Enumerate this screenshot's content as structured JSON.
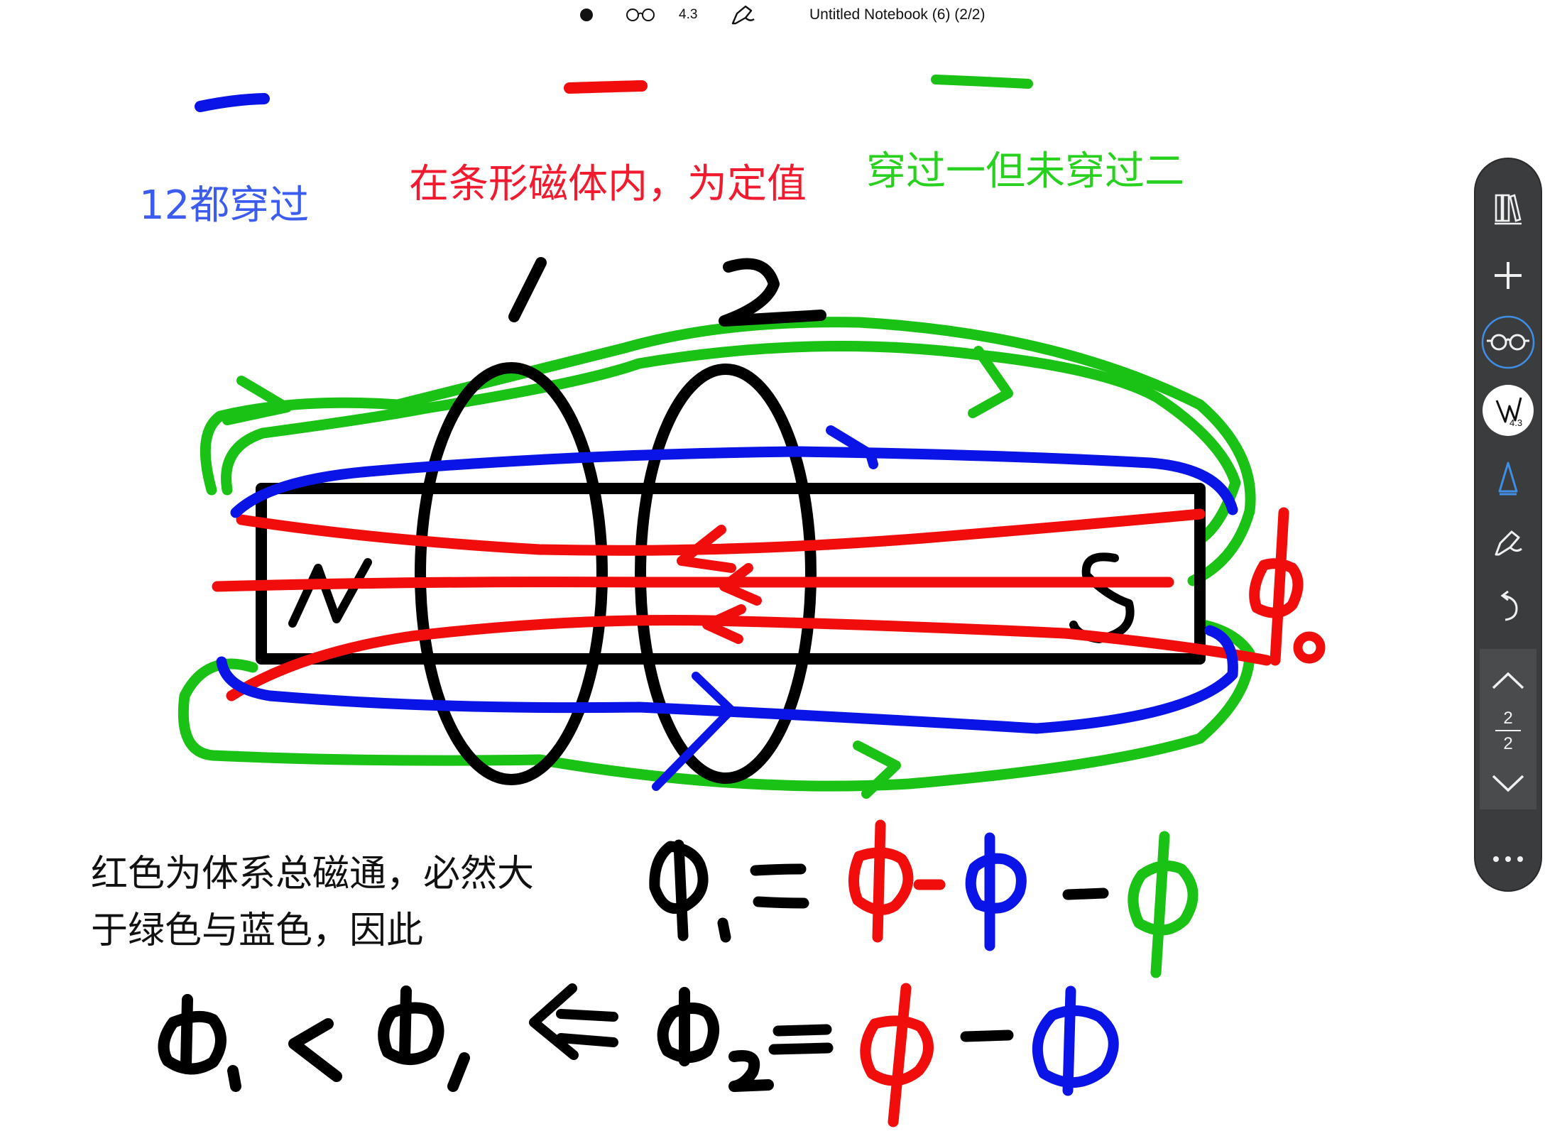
{
  "app": {
    "title": "Untitled Notebook (6) (2/2)",
    "zoom": "4.3"
  },
  "toolbar": {
    "pen_badge": "4.3",
    "page_current": "2",
    "page_total": "2"
  },
  "notes": {
    "blue_label": "12都穿过",
    "red_label": "在条形磁体内，为定值",
    "green_label": "穿过一但未穿过二",
    "explain_line1": "红色为体系总磁通，必然大",
    "explain_line2": "于绿色与蓝色，因此"
  },
  "sketch": {
    "coil_labels": [
      "1",
      "2"
    ],
    "pole_north": "N",
    "pole_south": "S"
  },
  "colors": {
    "blue": "#0a14e6",
    "red": "#f20d0d",
    "green": "#19c214",
    "ink": "#000000",
    "label_blue": "#3c5cf0",
    "label_red": "#f21a2e",
    "label_green": "#29d11f"
  },
  "icons": [
    "dot-icon",
    "glasses-icon",
    "pen-icon",
    "library-icon",
    "plus-icon",
    "pen-nib-icon",
    "highlighter-icon",
    "undo-icon",
    "chevron-up-icon",
    "chevron-down-icon",
    "more-icon"
  ]
}
